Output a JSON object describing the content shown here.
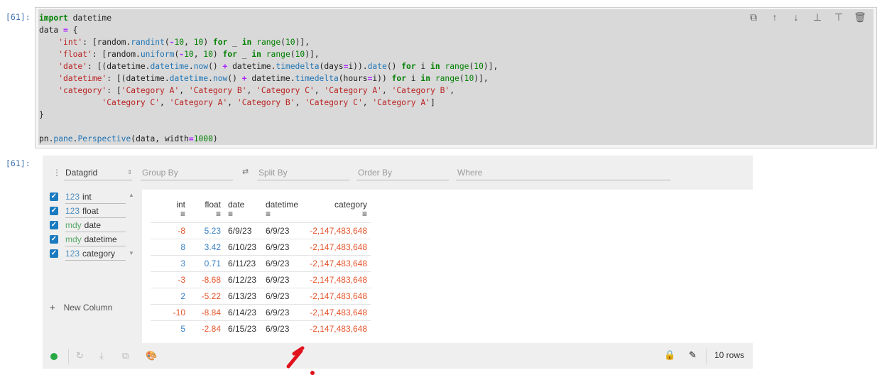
{
  "code_cell": {
    "prompt": "[61]:",
    "toolbar_icons": [
      "duplicate-icon",
      "move-up-icon",
      "move-down-icon",
      "insert-above-icon",
      "insert-below-icon",
      "delete-icon"
    ]
  },
  "output_cell": {
    "prompt": "[61]:"
  },
  "perspective": {
    "plugin": "Datagrid",
    "group_by_placeholder": "Group By",
    "split_by_placeholder": "Split By",
    "order_by_placeholder": "Order By",
    "where_placeholder": "Where",
    "columns": [
      {
        "type": "123",
        "name": "int"
      },
      {
        "type": "123",
        "name": "float"
      },
      {
        "type": "mdy",
        "name": "date"
      },
      {
        "type": "mdy",
        "name": "datetime"
      },
      {
        "type": "123",
        "name": "category"
      }
    ],
    "new_column_label": "New Column",
    "headers": [
      "int",
      "float",
      "date",
      "datetime",
      "category"
    ],
    "header_menu_glyph": "≡",
    "rows": [
      [
        "-8",
        "5.23",
        "6/9/23",
        "6/9/23",
        "-2,147,483,648"
      ],
      [
        "8",
        "3.42",
        "6/10/23",
        "6/9/23",
        "-2,147,483,648"
      ],
      [
        "3",
        "0.71",
        "6/11/23",
        "6/9/23",
        "-2,147,483,648"
      ],
      [
        "-3",
        "-8.68",
        "6/12/23",
        "6/9/23",
        "-2,147,483,648"
      ],
      [
        "2",
        "-5.22",
        "6/13/23",
        "6/9/23",
        "-2,147,483,648"
      ],
      [
        "-10",
        "-8.84",
        "6/14/23",
        "6/9/23",
        "-2,147,483,648"
      ],
      [
        "5",
        "-2.84",
        "6/15/23",
        "6/9/23",
        "-2,147,483,648"
      ]
    ],
    "row_count_label": "10 rows",
    "status_color": "#27a844"
  }
}
